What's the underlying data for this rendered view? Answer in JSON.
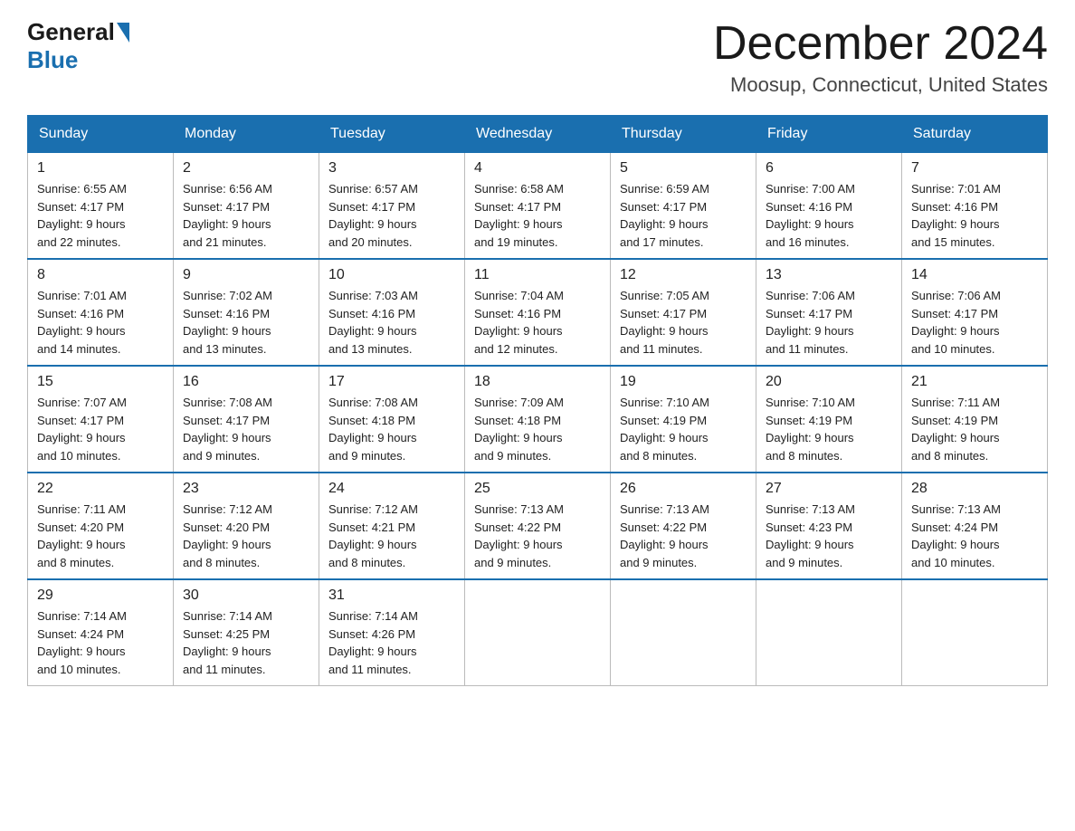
{
  "header": {
    "logo": {
      "part1": "General",
      "part2": "Blue"
    },
    "title": "December 2024",
    "location": "Moosup, Connecticut, United States"
  },
  "weekdays": [
    "Sunday",
    "Monday",
    "Tuesday",
    "Wednesday",
    "Thursday",
    "Friday",
    "Saturday"
  ],
  "weeks": [
    [
      {
        "day": "1",
        "sunrise": "6:55 AM",
        "sunset": "4:17 PM",
        "daylight": "9 hours and 22 minutes."
      },
      {
        "day": "2",
        "sunrise": "6:56 AM",
        "sunset": "4:17 PM",
        "daylight": "9 hours and 21 minutes."
      },
      {
        "day": "3",
        "sunrise": "6:57 AM",
        "sunset": "4:17 PM",
        "daylight": "9 hours and 20 minutes."
      },
      {
        "day": "4",
        "sunrise": "6:58 AM",
        "sunset": "4:17 PM",
        "daylight": "9 hours and 19 minutes."
      },
      {
        "day": "5",
        "sunrise": "6:59 AM",
        "sunset": "4:17 PM",
        "daylight": "9 hours and 17 minutes."
      },
      {
        "day": "6",
        "sunrise": "7:00 AM",
        "sunset": "4:16 PM",
        "daylight": "9 hours and 16 minutes."
      },
      {
        "day": "7",
        "sunrise": "7:01 AM",
        "sunset": "4:16 PM",
        "daylight": "9 hours and 15 minutes."
      }
    ],
    [
      {
        "day": "8",
        "sunrise": "7:01 AM",
        "sunset": "4:16 PM",
        "daylight": "9 hours and 14 minutes."
      },
      {
        "day": "9",
        "sunrise": "7:02 AM",
        "sunset": "4:16 PM",
        "daylight": "9 hours and 13 minutes."
      },
      {
        "day": "10",
        "sunrise": "7:03 AM",
        "sunset": "4:16 PM",
        "daylight": "9 hours and 13 minutes."
      },
      {
        "day": "11",
        "sunrise": "7:04 AM",
        "sunset": "4:16 PM",
        "daylight": "9 hours and 12 minutes."
      },
      {
        "day": "12",
        "sunrise": "7:05 AM",
        "sunset": "4:17 PM",
        "daylight": "9 hours and 11 minutes."
      },
      {
        "day": "13",
        "sunrise": "7:06 AM",
        "sunset": "4:17 PM",
        "daylight": "9 hours and 11 minutes."
      },
      {
        "day": "14",
        "sunrise": "7:06 AM",
        "sunset": "4:17 PM",
        "daylight": "9 hours and 10 minutes."
      }
    ],
    [
      {
        "day": "15",
        "sunrise": "7:07 AM",
        "sunset": "4:17 PM",
        "daylight": "9 hours and 10 minutes."
      },
      {
        "day": "16",
        "sunrise": "7:08 AM",
        "sunset": "4:17 PM",
        "daylight": "9 hours and 9 minutes."
      },
      {
        "day": "17",
        "sunrise": "7:08 AM",
        "sunset": "4:18 PM",
        "daylight": "9 hours and 9 minutes."
      },
      {
        "day": "18",
        "sunrise": "7:09 AM",
        "sunset": "4:18 PM",
        "daylight": "9 hours and 9 minutes."
      },
      {
        "day": "19",
        "sunrise": "7:10 AM",
        "sunset": "4:19 PM",
        "daylight": "9 hours and 8 minutes."
      },
      {
        "day": "20",
        "sunrise": "7:10 AM",
        "sunset": "4:19 PM",
        "daylight": "9 hours and 8 minutes."
      },
      {
        "day": "21",
        "sunrise": "7:11 AM",
        "sunset": "4:19 PM",
        "daylight": "9 hours and 8 minutes."
      }
    ],
    [
      {
        "day": "22",
        "sunrise": "7:11 AM",
        "sunset": "4:20 PM",
        "daylight": "9 hours and 8 minutes."
      },
      {
        "day": "23",
        "sunrise": "7:12 AM",
        "sunset": "4:20 PM",
        "daylight": "9 hours and 8 minutes."
      },
      {
        "day": "24",
        "sunrise": "7:12 AM",
        "sunset": "4:21 PM",
        "daylight": "9 hours and 8 minutes."
      },
      {
        "day": "25",
        "sunrise": "7:13 AM",
        "sunset": "4:22 PM",
        "daylight": "9 hours and 9 minutes."
      },
      {
        "day": "26",
        "sunrise": "7:13 AM",
        "sunset": "4:22 PM",
        "daylight": "9 hours and 9 minutes."
      },
      {
        "day": "27",
        "sunrise": "7:13 AM",
        "sunset": "4:23 PM",
        "daylight": "9 hours and 9 minutes."
      },
      {
        "day": "28",
        "sunrise": "7:13 AM",
        "sunset": "4:24 PM",
        "daylight": "9 hours and 10 minutes."
      }
    ],
    [
      {
        "day": "29",
        "sunrise": "7:14 AM",
        "sunset": "4:24 PM",
        "daylight": "9 hours and 10 minutes."
      },
      {
        "day": "30",
        "sunrise": "7:14 AM",
        "sunset": "4:25 PM",
        "daylight": "9 hours and 11 minutes."
      },
      {
        "day": "31",
        "sunrise": "7:14 AM",
        "sunset": "4:26 PM",
        "daylight": "9 hours and 11 minutes."
      },
      null,
      null,
      null,
      null
    ]
  ],
  "labels": {
    "sunrise": "Sunrise:",
    "sunset": "Sunset:",
    "daylight": "Daylight:"
  }
}
